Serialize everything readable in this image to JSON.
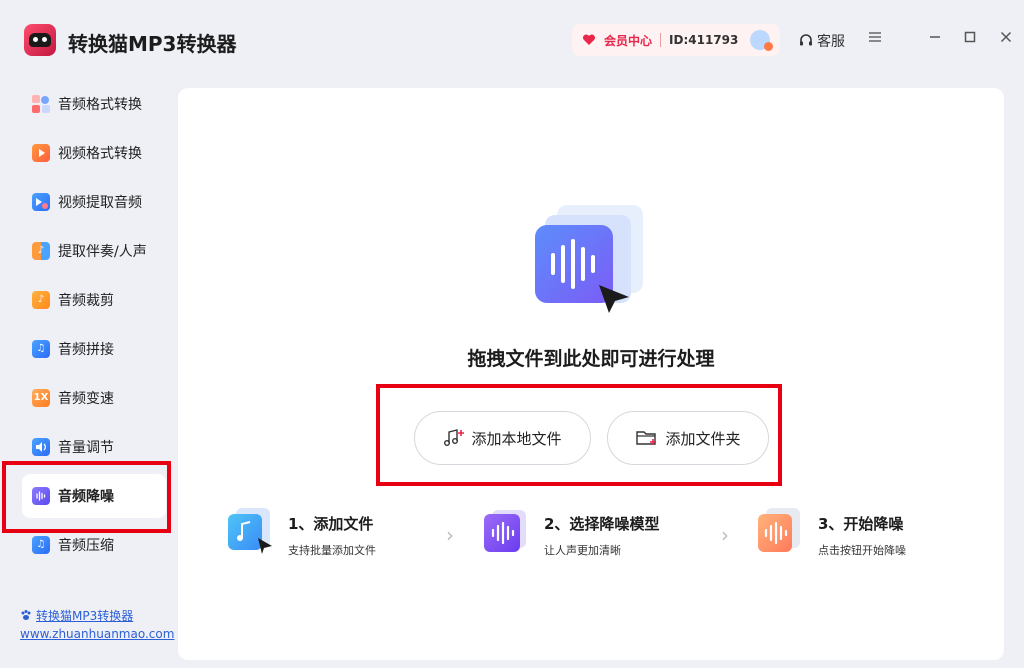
{
  "app": {
    "title": "转换猫MP3转换器",
    "logo_icon": "cat-logo-icon"
  },
  "header": {
    "member_center": "会员中心",
    "user_id": "ID:411793",
    "service": "客服",
    "accent": "#e8274a"
  },
  "sidebar": {
    "items": [
      {
        "label": "音频格式转换",
        "icon": "audio-format-icon"
      },
      {
        "label": "视频格式转换",
        "icon": "video-format-icon"
      },
      {
        "label": "视频提取音频",
        "icon": "extract-audio-icon"
      },
      {
        "label": "提取伴奏/人声",
        "icon": "vocal-split-icon"
      },
      {
        "label": "音频裁剪",
        "icon": "audio-cut-icon"
      },
      {
        "label": "音频拼接",
        "icon": "audio-merge-icon"
      },
      {
        "label": "音频变速",
        "icon": "audio-speed-icon",
        "badge": "1X"
      },
      {
        "label": "音量调节",
        "icon": "volume-icon"
      },
      {
        "label": "音频降噪",
        "icon": "denoise-icon",
        "active": true
      },
      {
        "label": "音频压缩",
        "icon": "compress-icon"
      }
    ],
    "footer_link": "转换猫MP3转换器",
    "footer_url": "www.zhuanhuanmao.com"
  },
  "main": {
    "drop_text": "拖拽文件到此处即可进行处理",
    "add_file": "添加本地文件",
    "add_folder": "添加文件夹",
    "steps": [
      {
        "title": "1、添加文件",
        "desc": "支持批量添加文件"
      },
      {
        "title": "2、选择降噪模型",
        "desc": "让人声更加清晰"
      },
      {
        "title": "3、开始降噪",
        "desc": "点击按钮开始降噪"
      }
    ],
    "primary_color": "#6b5cf6"
  }
}
